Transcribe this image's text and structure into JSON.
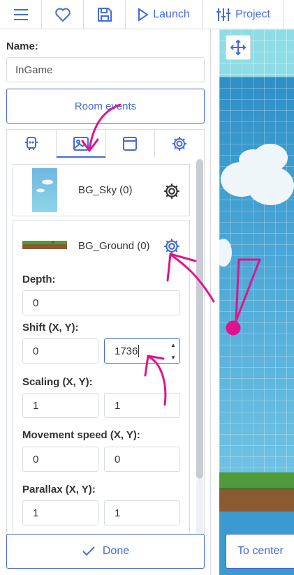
{
  "toolbar": {
    "launch_label": "Launch",
    "project_label": "Project"
  },
  "room": {
    "name_label": "Name:",
    "name_value": "InGame",
    "room_events_label": "Room events"
  },
  "tabs": [
    {
      "icon": "copy-icon",
      "active": false
    },
    {
      "icon": "image-icon",
      "active": true
    },
    {
      "icon": "window-icon",
      "active": false
    },
    {
      "icon": "gear-icon",
      "active": false
    }
  ],
  "backgrounds": [
    {
      "title": "BG_Sky (0)"
    },
    {
      "title": "BG_Ground (0)"
    }
  ],
  "fields": {
    "depth_label": "Depth:",
    "depth_value": "0",
    "shift_label": "Shift (X, Y):",
    "shift_x": "0",
    "shift_y": "1736",
    "scaling_label": "Scaling (X, Y):",
    "scaling_x": "1",
    "scaling_y": "1",
    "movement_label": "Movement speed (X, Y):",
    "movement_x": "0",
    "movement_y": "0",
    "parallax_label": "Parallax (X, Y):",
    "parallax_x": "1",
    "parallax_y": "1"
  },
  "footer": {
    "done_label": "Done",
    "to_center_label": "To center"
  },
  "colors": {
    "accent": "#446adb",
    "annotation": "#e0138c",
    "border": "#d7dce3"
  }
}
